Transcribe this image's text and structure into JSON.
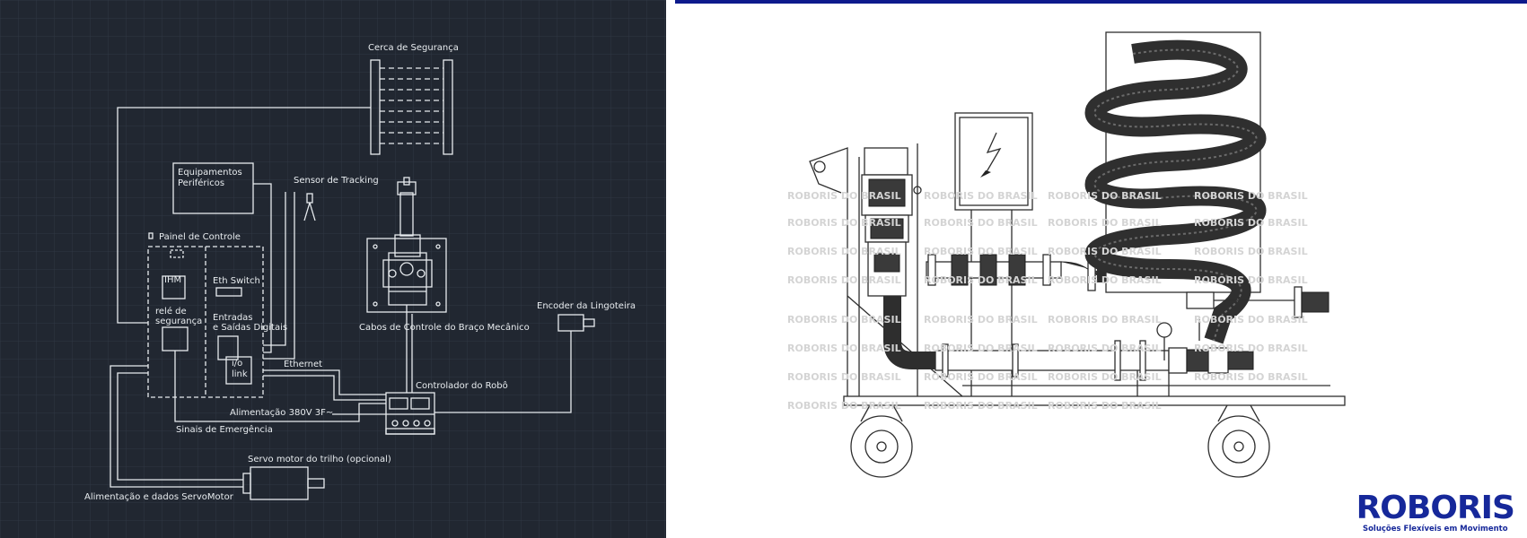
{
  "left_diagram": {
    "labels": {
      "fence": "Cerca de Segurança",
      "peripherals_1": "Equipamentos",
      "peripherals_2": "Periféricos",
      "tracking_sensor": "Sensor de Tracking",
      "control_panel": "Painel de Controle",
      "ihm": "IHM",
      "eth_switch": "Eth Switch",
      "safety_relay_1": "relé de",
      "safety_relay_2": "segurança",
      "digital_io_1": "Entradas",
      "digital_io_2": "e Saídas Digitais",
      "io_link_1": "i/o",
      "io_link_2": "link",
      "ethernet": "Ethernet",
      "arm_cables": "Cabos de Controle do Braço Mecânico",
      "encoder": "Encoder da Lingoteira",
      "robot_controller": "Controlador do Robô",
      "power": "Alimentação 380V 3F~",
      "emergency": "Sinais de Emergência",
      "servo_motor": "Servo motor do trilho (opcional)",
      "servo_power": "Alimentação e dados ServoMotor"
    }
  },
  "right_drawing": {
    "watermark": "ROBORIS DO BRASIL",
    "logo_name": "ROBORIS",
    "logo_tagline": "Soluções Flexíveis em Movimento",
    "top_bar_color": "#0d1a8c",
    "brand_color": "#16289a"
  }
}
